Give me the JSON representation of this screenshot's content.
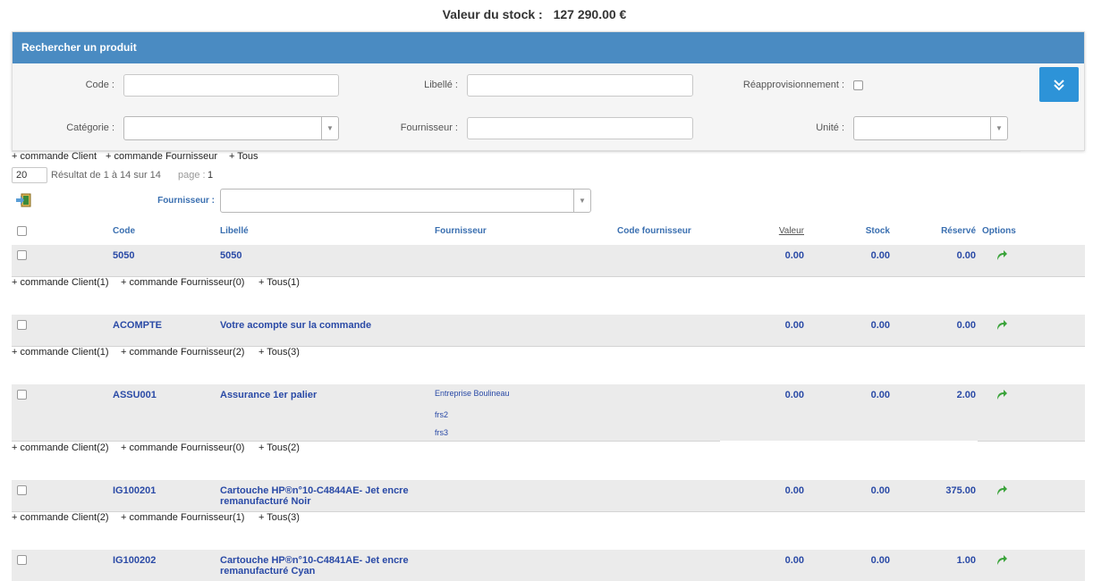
{
  "stock": {
    "label": "Valeur du stock :",
    "value": "127 290.00 €"
  },
  "search": {
    "title": "Rechercher un produit",
    "code_label": "Code :",
    "libelle_label": "Libellé :",
    "reappro_label": "Réapprovisionnement :",
    "categorie_label": "Catégorie :",
    "fournisseur_label": "Fournisseur :",
    "unite_label": "Unité :",
    "code_value": "",
    "libelle_value": "",
    "fournisseur_value": "",
    "categorie_value": "",
    "unite_value": ""
  },
  "toggle_icon": "double-chevron-down-icon",
  "quick_links": [
    "+ commande Client",
    "+ commande Fournisseur",
    "+ Tous"
  ],
  "pager": {
    "per_page": "20",
    "result_text": "Résultat de 1 à 14 sur 14",
    "page_label": "page :",
    "page_number": "1"
  },
  "filter": {
    "fournisseur_label": "Fournisseur :",
    "fournisseur_value": ""
  },
  "table": {
    "headers": {
      "code": "Code",
      "libelle": "Libellé",
      "fournisseur": "Fournisseur",
      "code_fournisseur": "Code fournisseur",
      "valeur": "Valeur",
      "stock": "Stock",
      "reserve": "Réservé",
      "options": "Options"
    },
    "rows": [
      {
        "code": "5050",
        "libelle": [
          "5050"
        ],
        "fournisseurs": [],
        "valeur": "0.00",
        "stock": "0.00",
        "reserve": "0.00",
        "links": [
          "+ commande Client(1)",
          "+ commande Fournisseur(0)",
          "+ Tous(1)"
        ]
      },
      {
        "code": "ACOMPTE",
        "libelle": [
          "Votre acompte sur la commande"
        ],
        "fournisseurs": [],
        "valeur": "0.00",
        "stock": "0.00",
        "reserve": "0.00",
        "links": [
          "+ commande Client(1)",
          "+ commande Fournisseur(2)",
          "+ Tous(3)"
        ]
      },
      {
        "code": "ASSU001",
        "libelle": [
          "Assurance 1er palier"
        ],
        "fournisseurs": [
          "Entreprise Boulineau",
          "frs2",
          "frs3"
        ],
        "valeur": "0.00",
        "stock": "0.00",
        "reserve": "2.00",
        "links": [
          "+ commande Client(2)",
          "+ commande Fournisseur(0)",
          "+ Tous(2)"
        ]
      },
      {
        "code": "IG100201",
        "libelle": [
          "Cartouche HP®n°10-C4844AE- Jet encre",
          "remanufacturé Noir"
        ],
        "fournisseurs": [],
        "valeur": "0.00",
        "stock": "0.00",
        "reserve": "375.00",
        "links": [
          "+ commande Client(2)",
          "+ commande Fournisseur(1)",
          "+ Tous(3)"
        ]
      },
      {
        "code": "IG100202",
        "libelle": [
          "Cartouche HP®n°10-C4841AE- Jet encre",
          "remanufacturé Cyan"
        ],
        "fournisseurs": [],
        "valeur": "0.00",
        "stock": "0.00",
        "reserve": "1.00",
        "links": []
      }
    ]
  },
  "colors": {
    "header_blue": "#4a8bc2",
    "toggle_blue": "#2d93d8",
    "link_blue": "#2a4aa6",
    "option_green": "#3aa33a"
  }
}
